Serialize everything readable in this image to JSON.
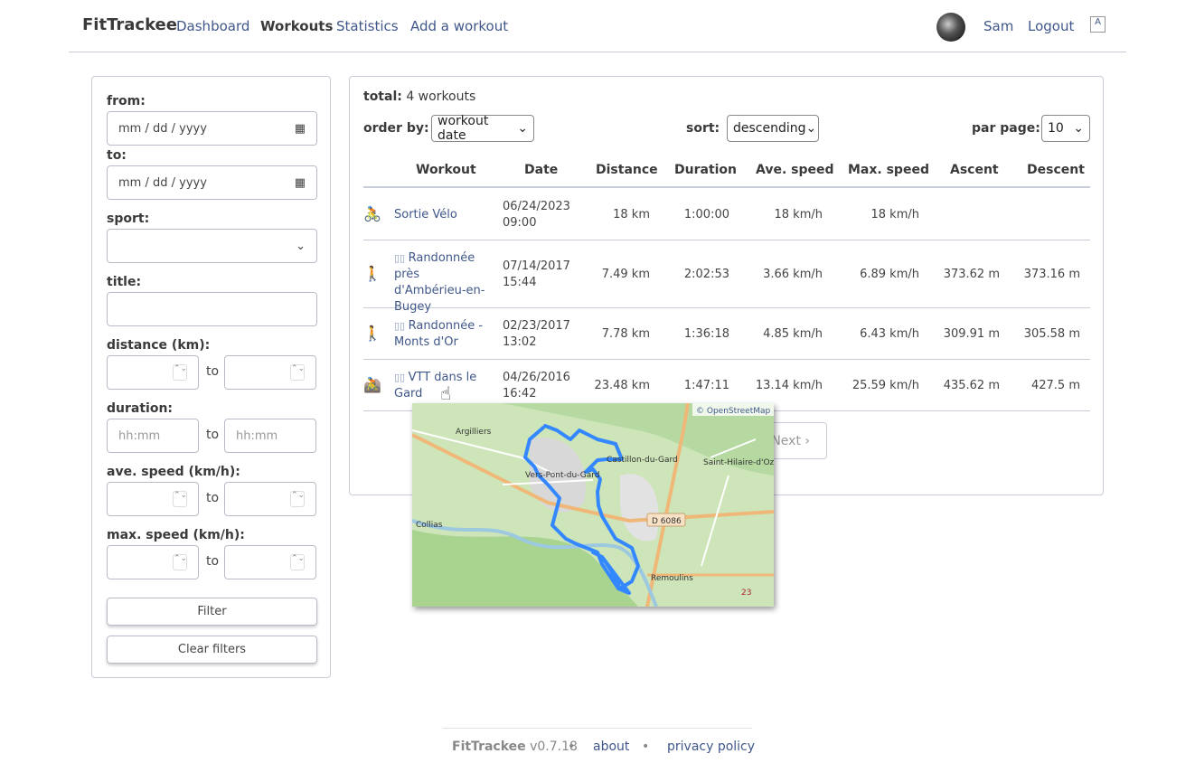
{
  "nav": {
    "brand": "FitTrackee",
    "links": [
      "Dashboard",
      "Workouts",
      "Statistics",
      "Add a workout"
    ],
    "user": "Sam",
    "logout": "Logout",
    "lang_icon": "language-icon"
  },
  "filters": {
    "from_label": "from:",
    "from_value": "mm / dd / yyyy",
    "to_label": "to:",
    "to_value": "mm / dd / yyyy",
    "sport_label": "sport:",
    "sport_value": "",
    "title_label": "title:",
    "title_value": "",
    "distance_label": "distance (km):",
    "duration_label": "duration:",
    "duration_placeholder": "hh:mm",
    "ave_speed_label": "ave. speed (km/h):",
    "max_speed_label": "max. speed (km/h):",
    "to_sep": "to",
    "filter_button": "Filter",
    "clear_button": "Clear filters"
  },
  "list": {
    "total_label": "total:",
    "total_value": "4 workouts",
    "order_by_label": "order by:",
    "order_by_value": "workout date",
    "sort_label": "sort:",
    "sort_value": "descending",
    "per_page_label": "par page:",
    "per_page_value": "10",
    "columns": [
      "Workout",
      "Date",
      "Distance",
      "Duration",
      "Ave. speed",
      "Max. speed",
      "Ascent",
      "Descent"
    ],
    "rows": [
      {
        "sport": "cycling",
        "color": "#3c9a8a",
        "title": "Sortie Vélo",
        "date": "06/24/2023",
        "time": "09:00",
        "distance": "18 km",
        "duration": "1:00:00",
        "ave": "18 km/h",
        "max": "18 km/h",
        "ascent": "",
        "descent": "",
        "has_map": false
      },
      {
        "sport": "hiking",
        "color": "#c0676a",
        "title": "Randonnée près d'Ambérieu-en-Bugey",
        "date": "07/14/2017",
        "time": "15:44",
        "distance": "7.49 km",
        "duration": "2:02:53",
        "ave": "3.66 km/h",
        "max": "6.89 km/h",
        "ascent": "373.62 m",
        "descent": "373.16 m",
        "has_map": true
      },
      {
        "sport": "hiking",
        "color": "#c0676a",
        "title": "Randonnée - Monts d'Or",
        "date": "02/23/2017",
        "time": "13:02",
        "distance": "7.78 km",
        "duration": "1:36:18",
        "ave": "4.85 km/h",
        "max": "6.43 km/h",
        "ascent": "309.91 m",
        "descent": "305.58 m",
        "has_map": true
      },
      {
        "sport": "mountain-biking",
        "color": "#d4aa55",
        "title": "VTT dans le Gard",
        "date": "04/26/2016",
        "time": "16:42",
        "distance": "23.48 km",
        "duration": "1:47:11",
        "ave": "13.14 km/h",
        "max": "25.59 km/h",
        "ascent": "435.62 m",
        "descent": "427.5 m",
        "has_map": true
      }
    ],
    "next_label": "Next"
  },
  "map": {
    "attribution": "© OpenStreetMap",
    "places": [
      "Argilliers",
      "Castillon-du-Gard",
      "Saint-Hilaire-d'Ozilhan",
      "Vers-Pont-du-Gard",
      "Collias",
      "D 6086",
      "Remoulins",
      "23"
    ],
    "route_color": "#3388ff"
  },
  "footer": {
    "brand": "FitTrackee",
    "version": "v0.7.18",
    "about": "about",
    "privacy": "privacy policy"
  }
}
